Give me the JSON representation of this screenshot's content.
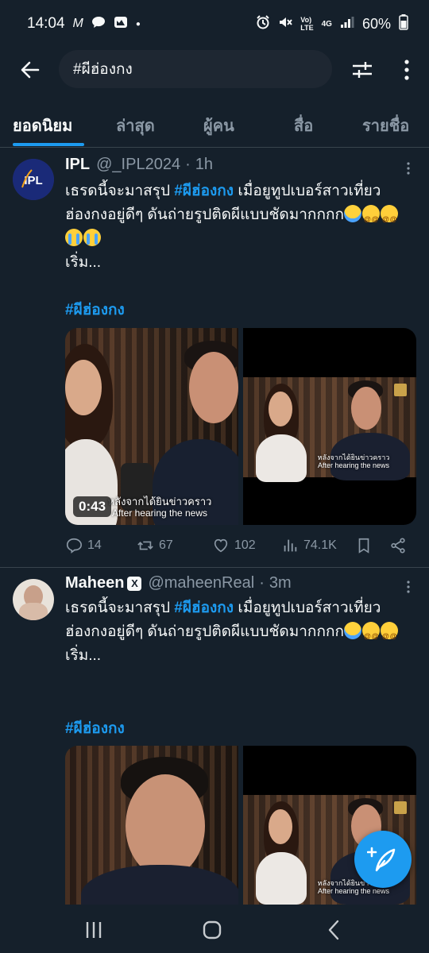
{
  "status_bar": {
    "time": "14:04",
    "carrier_indicator": "M",
    "network_top": "Vo)",
    "network_bottom": "LTE",
    "gen": "4G",
    "battery": "60%"
  },
  "search": {
    "query": "#ผีฮ่องกง"
  },
  "tabs": [
    {
      "label": "ยอดนิยม",
      "active": true
    },
    {
      "label": "ล่าสุด",
      "active": false
    },
    {
      "label": "ผู้คน",
      "active": false
    },
    {
      "label": "สื่อ",
      "active": false
    },
    {
      "label": "รายชื่อ",
      "active": false
    }
  ],
  "tweets": [
    {
      "name": "IPL",
      "handle": "@_IPL2024",
      "dot": "·",
      "time": "1h",
      "text_before": "เธรดนี้จะมาสรุป ",
      "hashtag_inline": "#ผีฮ่องกง",
      "text_after": " เมื่อยูทูปเบอร์สาวเที่ยวฮ่องกงอยู่ดีๆ ดันถ่ายรูปติดผีแบบชัดมากกกก",
      "emojis": [
        "scream",
        "dizzy",
        "dizzy",
        "cry",
        "cry"
      ],
      "text_more": "เริ่ม...",
      "hashtag_line": "#ผีฮ่องกง",
      "media": {
        "duration": "0:43",
        "subtitle_th": "หลังจากได้ยินข่าวคราว",
        "subtitle_en": "After hearing the news"
      },
      "stats": {
        "replies": "14",
        "retweets": "67",
        "likes": "102",
        "views": "74.1K"
      }
    },
    {
      "name": "Maheen",
      "badge": "X",
      "handle": "@maheenReal",
      "dot": "·",
      "time": "3m",
      "text_before": "เธรดนี้จะมาสรุป ",
      "hashtag_inline": "#ผีฮ่องกง",
      "text_after": " เมื่อยูทูปเบอร์สาวเที่ยวฮ่องกงอยู่ดีๆ ดันถ่ายรูปติดผีแบบชัดมากกกก",
      "emojis": [
        "scream",
        "dizzy",
        "dizzy"
      ],
      "text_more": "เริ่ม...",
      "hashtag_line": "#ผีฮ่องกง",
      "media": {
        "subtitle_th": "หลังจากได้ยินข่าวคราว",
        "subtitle_en": "After hearing the news"
      }
    }
  ],
  "colors": {
    "background": "#15202b",
    "accent": "#1d9bf0",
    "muted": "#8b98a5",
    "divider": "#38444d"
  }
}
